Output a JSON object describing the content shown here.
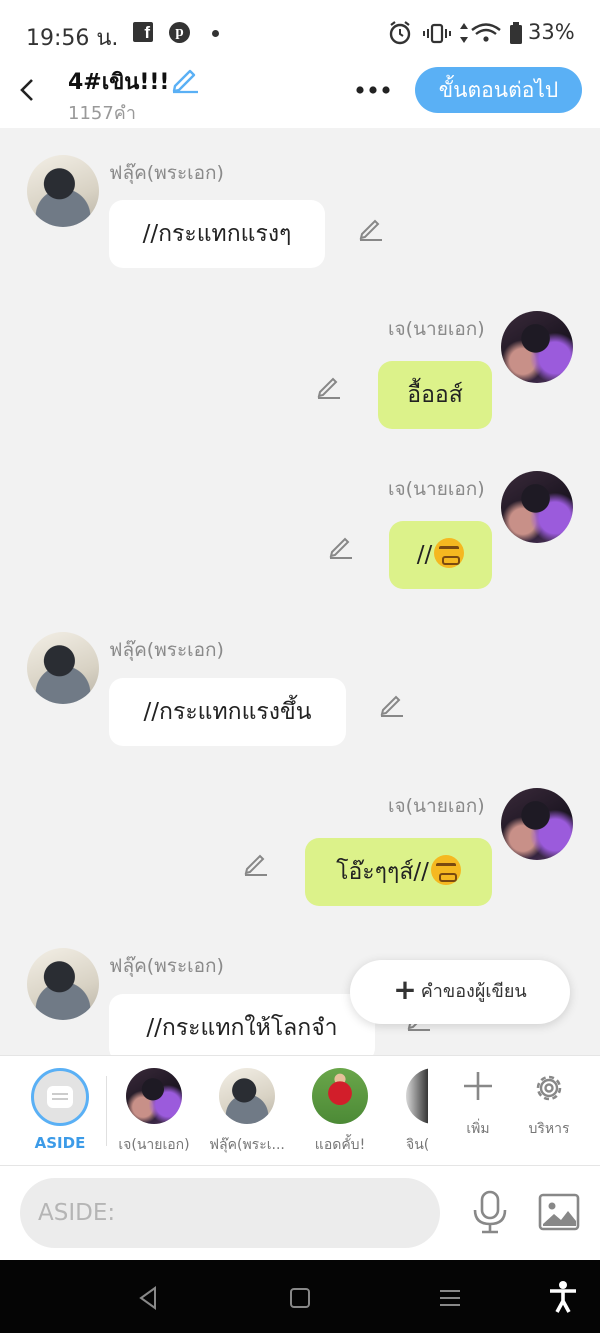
{
  "status_bar": {
    "time": "19:56 น.",
    "battery": "33%"
  },
  "header": {
    "title": "4#เขิน!!!",
    "word_count": "1157คำ",
    "next_button": "ขั้นตอนต่อไป"
  },
  "messages": [
    {
      "side": "left",
      "speaker": "ฟลุ๊ค(พระเอก)",
      "text": "//กระแทกแรงๆ"
    },
    {
      "side": "right",
      "speaker": "เจ(นายเอก)",
      "text": "อื้ออส์"
    },
    {
      "side": "right",
      "speaker": "เจ(นายเอก)",
      "text": "//",
      "emoji": "confounded-face"
    },
    {
      "side": "left",
      "speaker": "ฟลุ๊ค(พระเอก)",
      "text": "//กระแทกแรงขึ้น"
    },
    {
      "side": "right",
      "speaker": "เจ(นายเอก)",
      "text": "โอ๊ะๆๆส์//",
      "emoji": "confounded-face"
    },
    {
      "side": "left",
      "speaker": "ฟลุ๊ค(พระเอก)",
      "text": "//กระแทกให้โลกจำ"
    }
  ],
  "author_note_button": "คำของผู้เขียน",
  "character_bar": {
    "aside_label": "ASIDE",
    "characters": [
      {
        "label": "เจ(นายเอก)",
        "avatar": "jay"
      },
      {
        "label": "ฟลุ๊ค(พระเ...",
        "avatar": "flook"
      },
      {
        "label": "แอดคั้บ!",
        "avatar": "ad"
      },
      {
        "label": "จิน(",
        "avatar": "jin"
      }
    ],
    "add_label": "เพิ่ม",
    "manage_label": "บริหาร"
  },
  "input": {
    "placeholder": "ASIDE:"
  },
  "colors": {
    "accent": "#5ab0f5",
    "right_bubble": "#dcf28a",
    "left_bubble": "#ffffff",
    "background": "#f2f2f2"
  }
}
